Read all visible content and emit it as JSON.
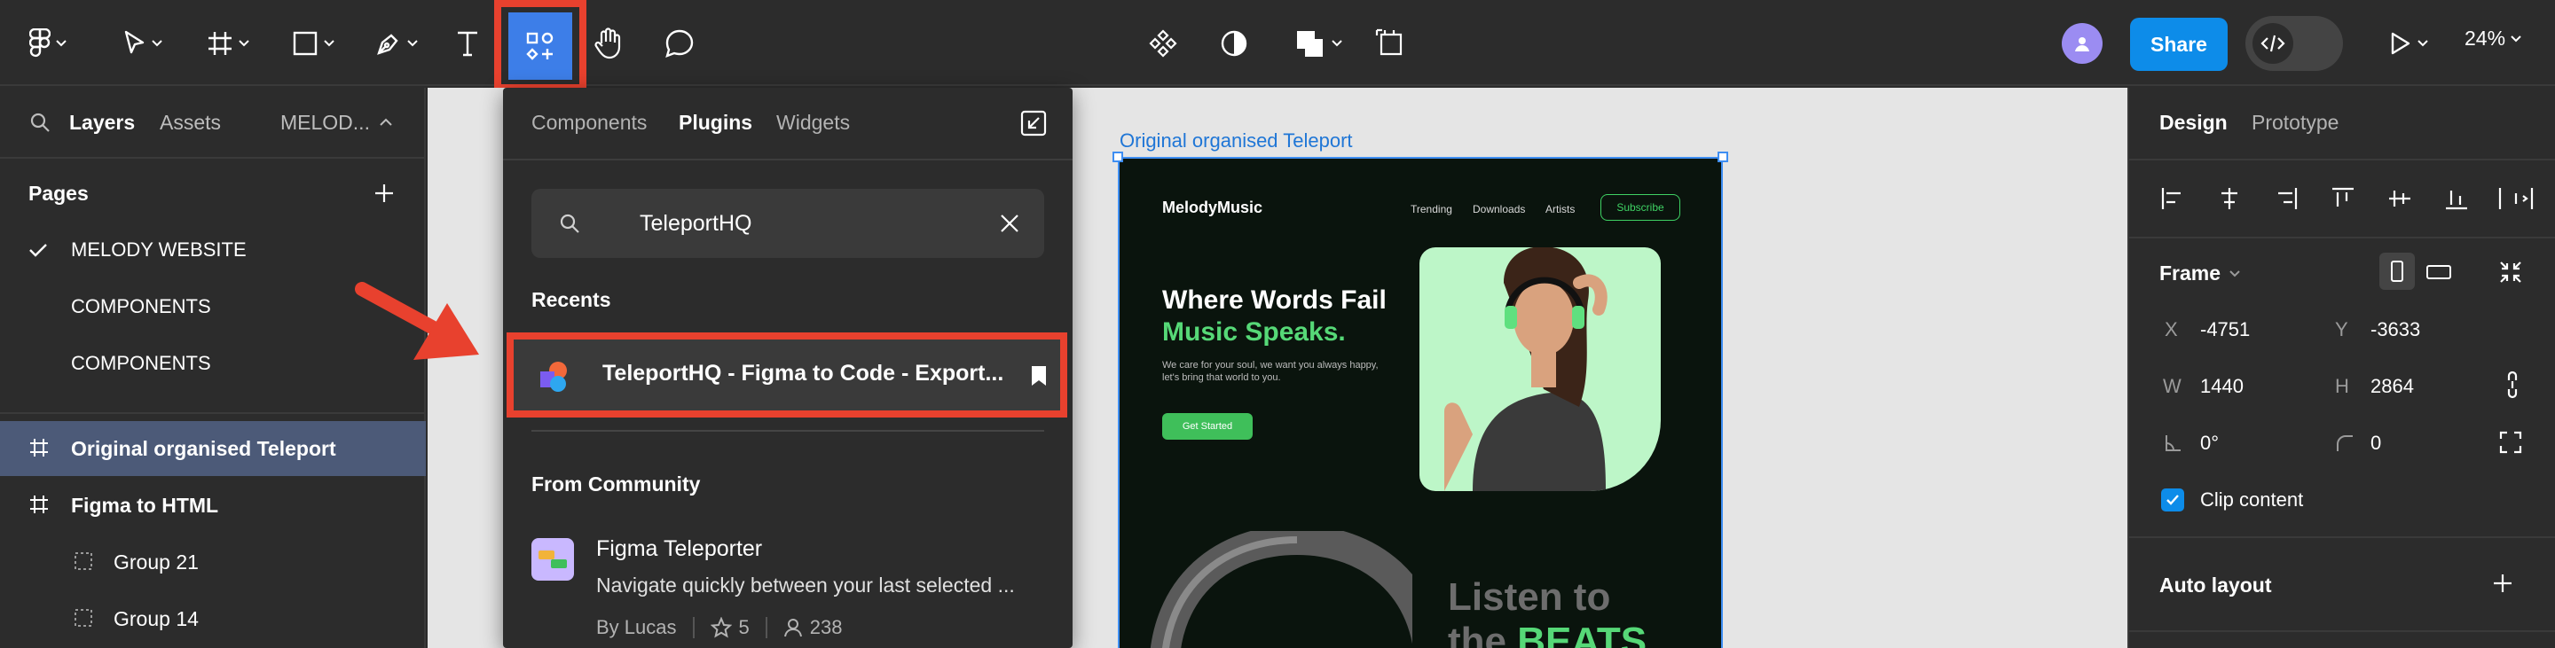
{
  "toolbar": {
    "zoom": "24%",
    "share_label": "Share"
  },
  "left_panel": {
    "tabs": {
      "layers": "Layers",
      "assets": "Assets",
      "file": "MELOD..."
    },
    "pages_title": "Pages",
    "pages": [
      {
        "label": "MELODY WEBSITE",
        "current": true
      },
      {
        "label": "COMPONENTS"
      },
      {
        "label": "COMPONENTS"
      }
    ],
    "layers": [
      {
        "label": "Original organised Teleport",
        "selected": true
      },
      {
        "label": "Figma to HTML"
      },
      {
        "label": "Group 21"
      },
      {
        "label": "Group 14"
      }
    ]
  },
  "popover": {
    "tabs": [
      "Components",
      "Plugins",
      "Widgets"
    ],
    "active_tab": "Plugins",
    "search_value": "TeleportHQ",
    "recents_title": "Recents",
    "recent_item": "TeleportHQ - Figma to Code - Export...",
    "community_title": "From Community",
    "community_item": {
      "title": "Figma Teleporter",
      "description": "Navigate quickly between your last selected ...",
      "author": "By Lucas",
      "stars": "5",
      "users": "238"
    }
  },
  "canvas": {
    "frame_label": "Original organised Teleport",
    "site": {
      "logo": "MelodyMusic",
      "nav": [
        "Trending",
        "Downloads",
        "Artists"
      ],
      "subscribe": "Subscribe",
      "headline_1": "Where Words Fail",
      "headline_2": "Music Speaks.",
      "paragraph": "We care for your soul, we want you always happy, let's bring that world to you.",
      "cta": "Get Started",
      "listen_1": "Listen to",
      "listen_2": "the ",
      "listen_beats": "BEATS"
    }
  },
  "right_panel": {
    "tabs": [
      "Design",
      "Prototype"
    ],
    "frame_title": "Frame",
    "x_label": "X",
    "x_value": "-4751",
    "y_label": "Y",
    "y_value": "-3633",
    "w_label": "W",
    "w_value": "1440",
    "h_label": "H",
    "h_value": "2864",
    "rotation_value": "0°",
    "radius_value": "0",
    "clip_content": "Clip content",
    "auto_layout": "Auto layout"
  },
  "colors": {
    "accent_blue": "#0d8ce9",
    "highlight_red": "#e8412e",
    "selection": "#4c5a78",
    "site_green": "#56d877"
  }
}
